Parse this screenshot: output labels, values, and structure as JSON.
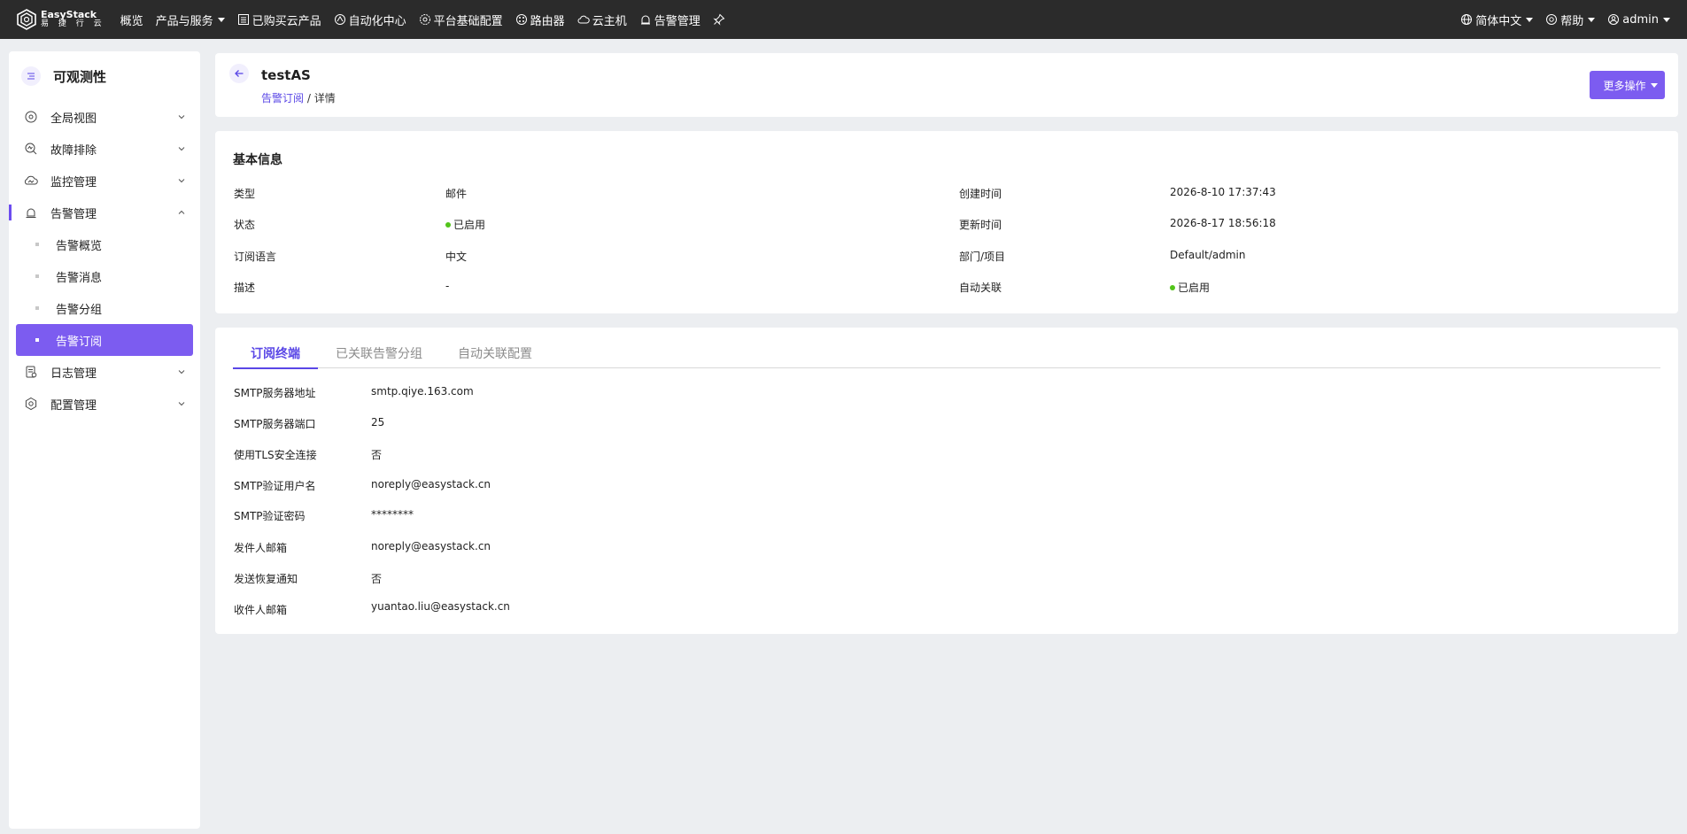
{
  "topbar": {
    "logo_line1": "EasyStack",
    "logo_line2": "易 捷 行 云",
    "nav": [
      {
        "label": "概览"
      },
      {
        "label": "产品与服务"
      },
      {
        "label": "已购买云产品",
        "icon": "list-icon"
      },
      {
        "label": "自动化中心",
        "icon": "automation-icon"
      },
      {
        "label": "平台基础配置",
        "icon": "settings-icon"
      },
      {
        "label": "路由器",
        "icon": "router-icon"
      },
      {
        "label": "云主机",
        "icon": "cloud-icon"
      },
      {
        "label": "告警管理",
        "icon": "alarm-icon"
      }
    ],
    "language": "简体中文",
    "help": "帮助",
    "user": "admin"
  },
  "sidebar": {
    "title": "可观测性",
    "items": [
      {
        "label": "全局视图"
      },
      {
        "label": "故障排除"
      },
      {
        "label": "监控管理"
      },
      {
        "label": "告警管理"
      },
      {
        "label": "日志管理"
      },
      {
        "label": "配置管理"
      }
    ],
    "sub_items": [
      {
        "label": "告警概览"
      },
      {
        "label": "告警消息"
      },
      {
        "label": "告警分组"
      },
      {
        "label": "告警订阅"
      }
    ]
  },
  "header": {
    "title": "testAS",
    "breadcrumb_link": "告警订阅",
    "breadcrumb_sep": "/",
    "breadcrumb_current": "详情",
    "more_label": "更多操作"
  },
  "basic": {
    "title": "基本信息",
    "left": [
      {
        "label": "类型",
        "value": "邮件"
      },
      {
        "label": "状态",
        "value": "已启用"
      },
      {
        "label": "订阅语言",
        "value": "中文"
      },
      {
        "label": "描述",
        "value": "-"
      }
    ],
    "right": [
      {
        "label": "创建时间",
        "value": "2026-8-10 17:37:43"
      },
      {
        "label": "更新时间",
        "value": "2026-8-17 18:56:18"
      },
      {
        "label": "部门/项目",
        "value": "Default/admin"
      },
      {
        "label": "自动关联",
        "value": "已启用"
      }
    ],
    "status_color": "#52c41a"
  },
  "tabs": [
    {
      "label": "订阅终端"
    },
    {
      "label": "已关联告警分组"
    },
    {
      "label": "自动关联配置"
    }
  ],
  "endpoint": [
    {
      "label": "SMTP服务器地址",
      "value": "smtp.qiye.163.com"
    },
    {
      "label": "SMTP服务器端口",
      "value": "25"
    },
    {
      "label": "使用TLS安全连接",
      "value": "否"
    },
    {
      "label": "SMTP验证用户名",
      "value": "noreply@easystack.cn"
    },
    {
      "label": "SMTP验证密码",
      "value": "********"
    },
    {
      "label": "发件人邮箱",
      "value": "noreply@easystack.cn"
    },
    {
      "label": "发送恢复通知",
      "value": "否"
    },
    {
      "label": "收件人邮箱",
      "value": "yuantao.liu@easystack.cn"
    }
  ],
  "colors": {
    "accent": "#7c5cf0",
    "link": "#5a47e6",
    "topbar": "#2b2b2b"
  }
}
